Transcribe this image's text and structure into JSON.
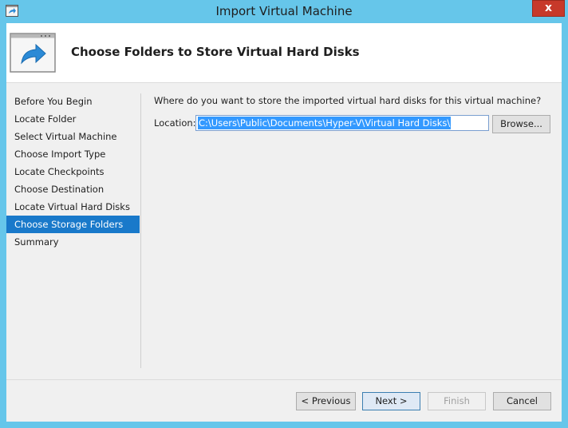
{
  "window": {
    "title": "Import Virtual Machine",
    "close_label": "x"
  },
  "header": {
    "title": "Choose Folders to Store Virtual Hard Disks"
  },
  "nav": {
    "items": [
      {
        "label": "Before You Begin",
        "selected": false
      },
      {
        "label": "Locate Folder",
        "selected": false
      },
      {
        "label": "Select Virtual Machine",
        "selected": false
      },
      {
        "label": "Choose Import Type",
        "selected": false
      },
      {
        "label": "Locate Checkpoints",
        "selected": false
      },
      {
        "label": "Choose Destination",
        "selected": false
      },
      {
        "label": "Locate Virtual Hard Disks",
        "selected": false
      },
      {
        "label": "Choose Storage Folders",
        "selected": true
      },
      {
        "label": "Summary",
        "selected": false
      }
    ]
  },
  "main": {
    "question": "Where do you want to store the imported virtual hard disks for this virtual machine?",
    "location_label": "Location:",
    "location_value": "C:\\Users\\Public\\Documents\\Hyper-V\\Virtual Hard Disks\\",
    "browse_label": "Browse..."
  },
  "footer": {
    "previous_label": "< Previous",
    "next_label": "Next >",
    "finish_label": "Finish",
    "cancel_label": "Cancel"
  },
  "colors": {
    "frame": "#66c6ea",
    "selection": "#1979ca",
    "close": "#c7392a"
  }
}
